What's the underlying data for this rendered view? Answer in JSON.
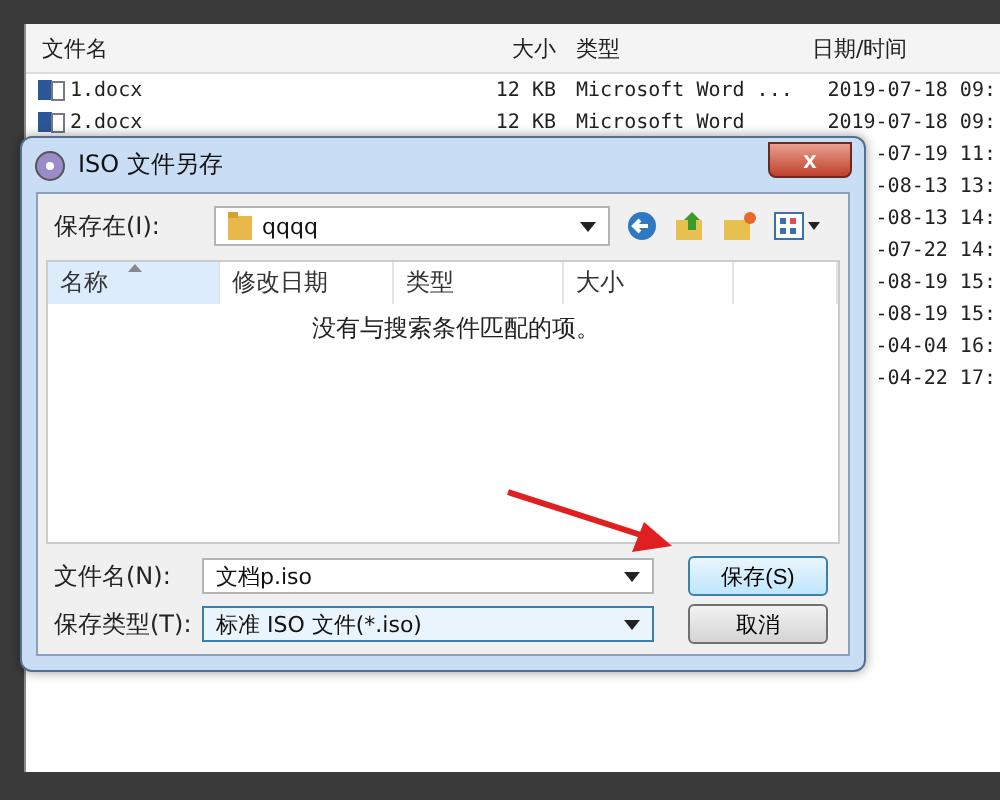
{
  "background_window": {
    "columns": [
      "文件名",
      "大小",
      "类型",
      "日期/时间"
    ],
    "rows": [
      {
        "name": "1.docx",
        "size": "12 KB",
        "type": "Microsoft Word ...",
        "date": "2019-07-18 09:"
      },
      {
        "name": "2.docx",
        "size": "12 KB",
        "type": "Microsoft Word",
        "date": "2019-07-18 09:"
      },
      {
        "date": "-07-19 11:"
      },
      {
        "date": "-08-13 13:"
      },
      {
        "date": "-08-13 14:"
      },
      {
        "date": "-07-22 14:"
      },
      {
        "date": "-08-19 15:"
      },
      {
        "date": "-08-19 15:"
      },
      {
        "date": "-04-04 16:"
      },
      {
        "date": "-04-22 17:"
      }
    ]
  },
  "dialog": {
    "title": "ISO 文件另存",
    "close": "x",
    "location": {
      "label": "保存在(I):",
      "value": "qqqq"
    },
    "list": {
      "columns": [
        {
          "label": "名称",
          "sorted": true
        },
        {
          "label": "修改日期",
          "sorted": false
        },
        {
          "label": "类型",
          "sorted": false
        },
        {
          "label": "大小",
          "sorted": false
        }
      ],
      "empty_message": "没有与搜索条件匹配的项。"
    },
    "filename": {
      "label": "文件名(N):",
      "value": "文档p.iso"
    },
    "filetype": {
      "label": "保存类型(T):",
      "value": "标准 ISO 文件(*.iso)"
    },
    "buttons": [
      {
        "label": "保存(S)",
        "default": true
      },
      {
        "label": "取消",
        "default": false
      }
    ]
  }
}
